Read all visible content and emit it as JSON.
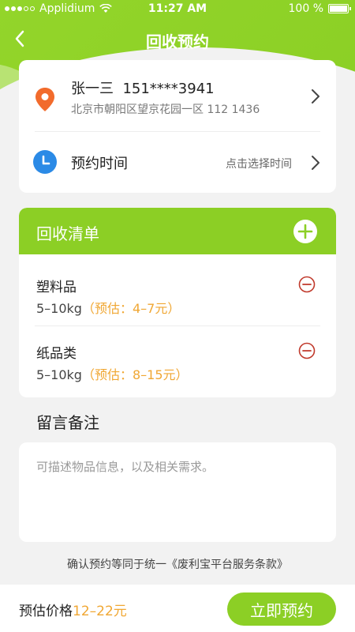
{
  "status_bar": {
    "carrier": "Applidium",
    "time": "11:27 AM",
    "battery": "100 %"
  },
  "nav": {
    "title": "回收预约"
  },
  "address": {
    "name_phone": "张一三  151****3941",
    "address_line": "北京市朝阳区望京花园一区 112 1436"
  },
  "appointment": {
    "label": "预约时间",
    "hint": "点击选择时间"
  },
  "recycle_list": {
    "title": "回收清单",
    "items": [
      {
        "name": "塑料品",
        "weight": "5–10kg",
        "estimate": "（预估：4–7元）"
      },
      {
        "name": "纸品类",
        "weight": "5–10kg",
        "estimate": "（预估：8–15元）"
      }
    ]
  },
  "remarks": {
    "title": "留言备注",
    "placeholder": "可描述物品信息，以及相关需求。"
  },
  "terms": {
    "prefix": "确认预约等同于统一",
    "link": "《废利宝平台服务条款》"
  },
  "bottom": {
    "price_label": "预估价格",
    "price_value": "12–22元",
    "submit_label": "立即预约"
  },
  "colors": {
    "brand_green": "#8ccf25",
    "estimate_orange": "#f0a733",
    "clock_blue": "#2b8ae6",
    "pin_orange": "#f26b2c",
    "remove_red": "#c0392b"
  },
  "icons": {
    "back": "chevron-left-icon",
    "location": "location-pin-icon",
    "clock": "clock-icon",
    "chevron": "chevron-right-icon",
    "add": "plus-circle-icon",
    "remove": "minus-circle-icon",
    "wifi": "wifi-icon",
    "battery": "battery-icon"
  }
}
